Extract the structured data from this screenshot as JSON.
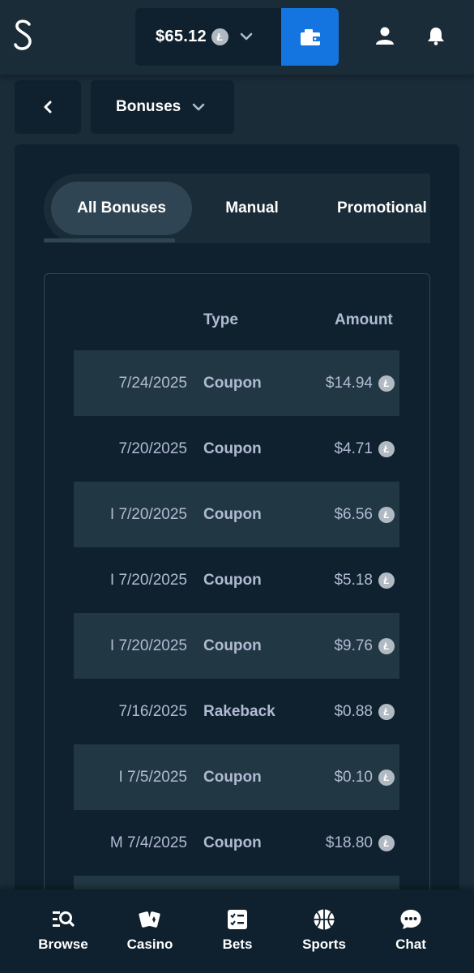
{
  "header": {
    "logo_text": "S",
    "balance": "$65.12",
    "currency_symbol": "Ł"
  },
  "subheader": {
    "dropdown_label": "Bonuses"
  },
  "tabs": [
    {
      "label": "All Bonuses",
      "active": true
    },
    {
      "label": "Manual",
      "active": false
    },
    {
      "label": "Promotional",
      "active": false
    }
  ],
  "table": {
    "headers": {
      "type": "Type",
      "amount": "Amount"
    },
    "rows": [
      {
        "date": "7/24/2025",
        "type": "Coupon",
        "amount": "$14.94"
      },
      {
        "date": "7/20/2025",
        "type": "Coupon",
        "amount": "$4.71"
      },
      {
        "date": "I 7/20/2025",
        "type": "Coupon",
        "amount": "$6.56"
      },
      {
        "date": "I 7/20/2025",
        "type": "Coupon",
        "amount": "$5.18"
      },
      {
        "date": "I 7/20/2025",
        "type": "Coupon",
        "amount": "$9.76"
      },
      {
        "date": "7/16/2025",
        "type": "Rakeback",
        "amount": "$0.88"
      },
      {
        "date": "I 7/5/2025",
        "type": "Coupon",
        "amount": "$0.10"
      },
      {
        "date": "M 7/4/2025",
        "type": "Coupon",
        "amount": "$18.80"
      }
    ]
  },
  "bottom_nav": [
    {
      "label": "Browse",
      "icon": "browse-icon"
    },
    {
      "label": "Casino",
      "icon": "cards-icon"
    },
    {
      "label": "Bets",
      "icon": "betslip-icon"
    },
    {
      "label": "Sports",
      "icon": "basketball-icon"
    },
    {
      "label": "Chat",
      "icon": "chat-icon"
    }
  ],
  "colors": {
    "background": "#1a2c38",
    "panel": "#0f212e",
    "accent": "#1475e1",
    "muted_text": "#b1bad3"
  }
}
